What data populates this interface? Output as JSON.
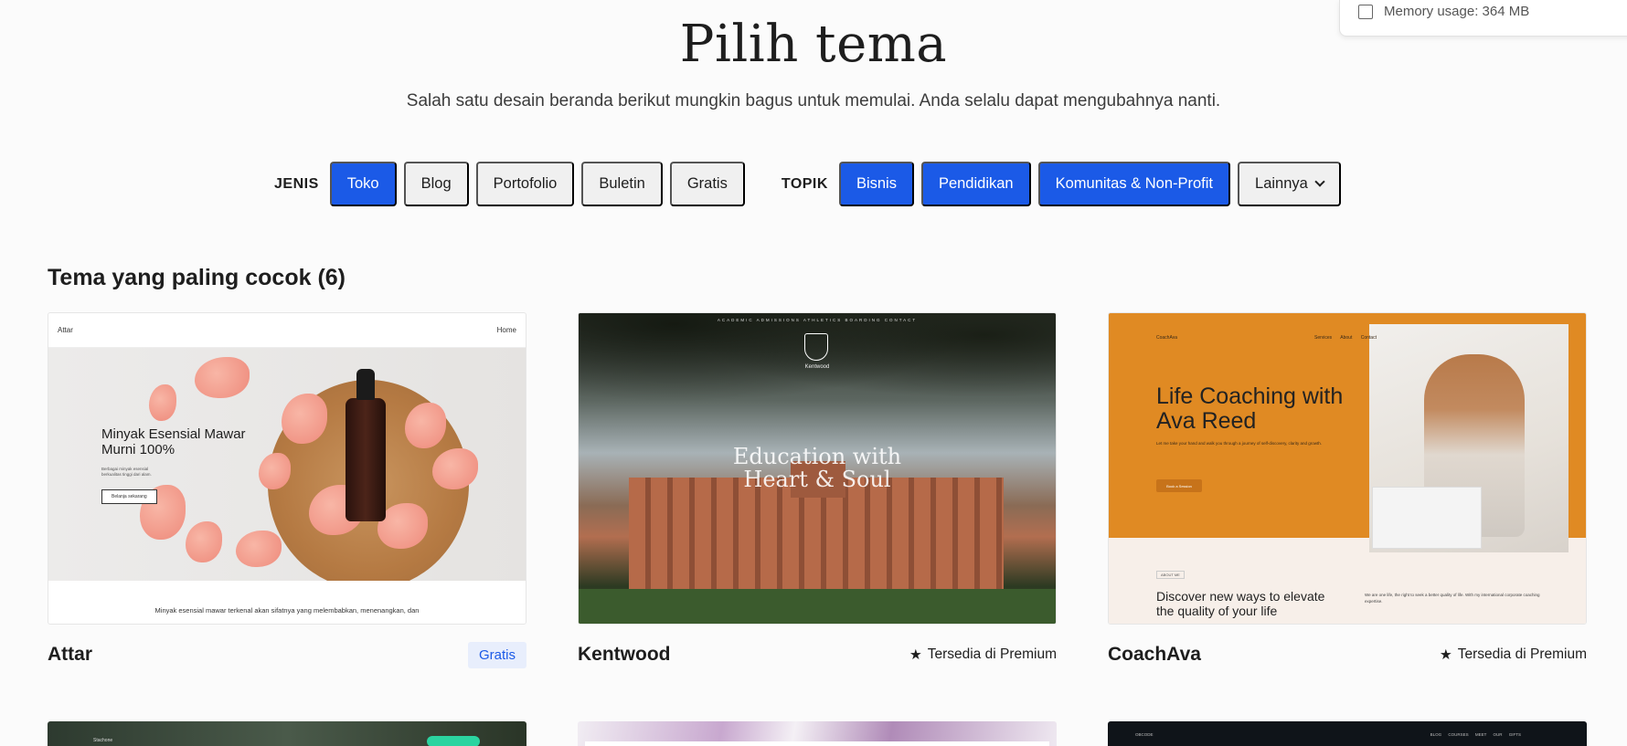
{
  "memory": {
    "text": "Memory usage: 364 MB"
  },
  "header": {
    "title": "Pilih tema",
    "subtitle": "Salah satu desain beranda berikut mungkin bagus untuk memulai. Anda selalu dapat mengubahnya nanti."
  },
  "filters": {
    "type_label": "JENIS",
    "types": [
      {
        "label": "Toko",
        "active": true
      },
      {
        "label": "Blog",
        "active": false
      },
      {
        "label": "Portofolio",
        "active": false
      },
      {
        "label": "Buletin",
        "active": false
      },
      {
        "label": "Gratis",
        "active": false
      }
    ],
    "topic_label": "TOPIK",
    "topics": [
      {
        "label": "Bisnis",
        "active": true
      },
      {
        "label": "Pendidikan",
        "active": true
      },
      {
        "label": "Komunitas & Non-Profit",
        "active": true
      }
    ],
    "more_label": "Lainnya"
  },
  "section": {
    "title": "Tema yang paling cocok (6)"
  },
  "themes": [
    {
      "name": "Attar",
      "badge": "Gratis",
      "preview": {
        "nav_brand": "Attar",
        "nav_link": "Home",
        "heading": "Minyak Esensial Mawar Murni 100%",
        "body": "Berbagai minyak esensial berkualitas tinggi dari alam.",
        "button": "Belanja sekarang",
        "caption": "Minyak esensial mawar terkenal akan sifatnya yang melembabkan, menenangkan, dan"
      }
    },
    {
      "name": "Kentwood",
      "premium": "Tersedia di Premium",
      "preview": {
        "topnav": "ACADEMIC ADMISSIONS  ATHLETICS  BOARDING  CONTACT",
        "brand": "Kentwood",
        "heading_line1": "Education with",
        "heading_line2": "Heart & Soul"
      }
    },
    {
      "name": "CoachAva",
      "premium": "Tersedia di Premium",
      "preview": {
        "brand": "CoachAva",
        "nav_links": "Services About Contact",
        "heading": "Life Coaching with Ava Reed",
        "body": "Let me take your hand and walk you through a journey of self-discovery, clarity and growth.",
        "button": "Book a Session",
        "tag": "ABOUT ME",
        "heading2": "Discover new ways to elevate the quality of your life",
        "body2": "We are one life, the right to seek a better quality of life. With my international corporate coaching expertise."
      }
    }
  ],
  "partials": [
    {
      "nav": "Stachone"
    },
    {},
    {
      "nav": "OBCODE",
      "links": "BLOG COURSES MEET OUR GIFTS"
    }
  ],
  "icons": {
    "star": "★",
    "memory": "memory-icon"
  },
  "colors": {
    "accent": "#1b5ae7",
    "chip_bg": "#f0f0f0",
    "badge_bg": "#e8eefc"
  }
}
